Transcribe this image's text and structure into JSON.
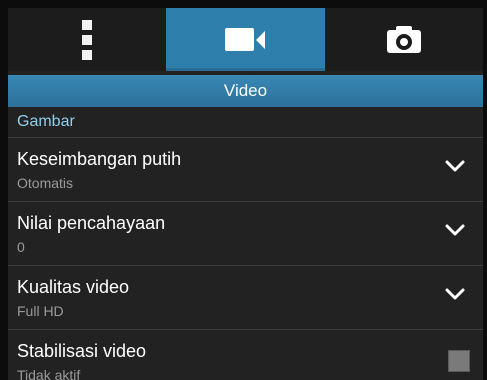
{
  "tabs": [
    {
      "icon": "more-vertical-icon",
      "active": false
    },
    {
      "icon": "video-camera-icon",
      "active": true
    },
    {
      "icon": "camera-icon",
      "active": false
    }
  ],
  "title": "Video",
  "section": "Gambar",
  "settings": [
    {
      "label": "Keseimbangan putih",
      "value": "Otomatis",
      "control": "dropdown"
    },
    {
      "label": "Nilai pencahayaan",
      "value": "0",
      "control": "dropdown"
    },
    {
      "label": "Kualitas video",
      "value": "Full HD",
      "control": "dropdown"
    },
    {
      "label": "Stabilisasi video",
      "value": "Tidak aktif",
      "control": "checkbox",
      "checked": false
    }
  ],
  "colors": {
    "accent": "#2f7fac",
    "section_text": "#8fd0ef",
    "background": "#222222"
  }
}
